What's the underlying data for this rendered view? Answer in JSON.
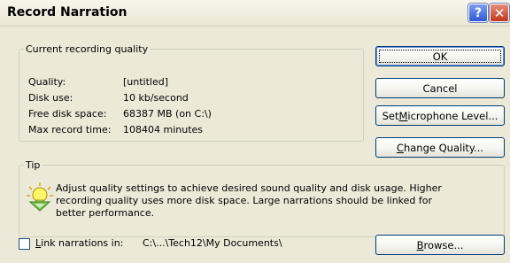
{
  "window": {
    "title": "Record Narration",
    "help_glyph": "?",
    "close_glyph": "✕"
  },
  "quality_group": {
    "legend": "Current recording quality",
    "rows": [
      {
        "label": "Quality:",
        "value": "[untitled]"
      },
      {
        "label": "Disk use:",
        "value": "10 kb/second"
      },
      {
        "label": "Free disk space:",
        "value": "68387 MB (on C:\\)"
      },
      {
        "label": "Max record time:",
        "value": "108404 minutes"
      }
    ]
  },
  "buttons": {
    "ok": "OK",
    "cancel": "Cancel",
    "mic_pre": "Set ",
    "mic_key": "M",
    "mic_post": "icrophone Level...",
    "quality_key": "C",
    "quality_post": "hange Quality...",
    "browse_key": "B",
    "browse_post": "rowse..."
  },
  "tip_group": {
    "legend": "Tip",
    "icon": "lightbulb-tip-icon",
    "text": "Adjust quality settings to achieve desired sound quality and disk usage. Higher recording quality uses more disk space. Large narrations should be linked for better performance."
  },
  "link": {
    "checked": false,
    "label_key": "L",
    "label_post": "ink narrations in:",
    "path": "C:\\...\\Tech12\\My Documents\\"
  },
  "colors": {
    "background": "#ece9d8",
    "button_border": "#003c74",
    "group_border": "#d0d0bf"
  }
}
